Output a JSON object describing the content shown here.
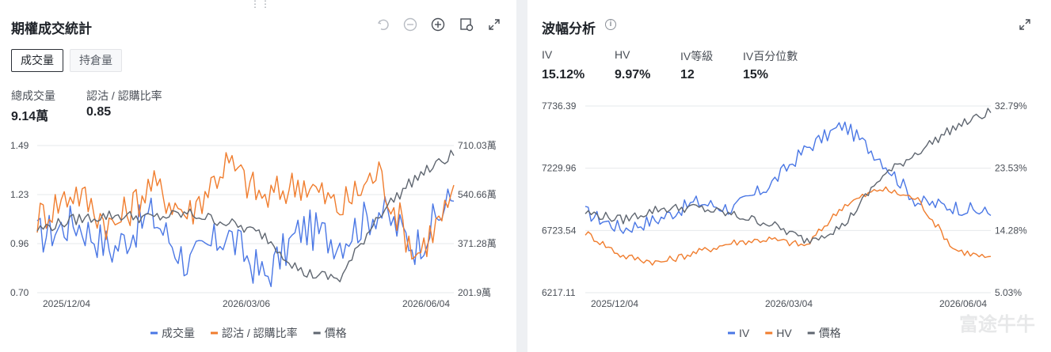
{
  "left": {
    "title": "期權成交統計",
    "tabs": [
      {
        "label": "成交量",
        "active": true
      },
      {
        "label": "持倉量",
        "active": false
      }
    ],
    "stats": [
      {
        "label": "總成交量",
        "value": "9.14萬"
      },
      {
        "label": "認沽 / 認購比率",
        "value": "0.85"
      }
    ]
  },
  "right": {
    "title": "波幅分析",
    "stats": [
      {
        "label": "IV",
        "value": "15.12%"
      },
      {
        "label": "HV",
        "value": "9.97%"
      },
      {
        "label": "IV等級",
        "value": "12"
      },
      {
        "label": "IV百分位數",
        "value": "15%"
      }
    ]
  },
  "watermark": "富途牛牛",
  "colors": {
    "blue": "#4a77e5",
    "orange": "#f07d2e",
    "gray": "#5f6670",
    "grid": "#e6e8eb"
  },
  "icons": [
    "undo-icon",
    "zoom-out-icon",
    "zoom-in-icon",
    "settings-icon",
    "expand-icon",
    "info-icon"
  ],
  "chart_data": [
    {
      "type": "line",
      "x_ticks": [
        "2025/12/04",
        "2026/03/06",
        "2026/06/04"
      ],
      "y_left": {
        "ticks": [
          "1.49",
          "1.23",
          "0.96",
          "0.70"
        ],
        "range": [
          0.7,
          1.49
        ]
      },
      "y_right": {
        "ticks": [
          "710.03萬",
          "540.66萬",
          "371.28萬",
          "201.9萬"
        ],
        "range": [
          201.9,
          710.03
        ],
        "unit": "萬"
      },
      "legend_position": "bottom",
      "grid": true,
      "series": [
        {
          "name": "成交量",
          "color": "#4a77e5",
          "axis": "left",
          "points": 12,
          "values": [
            1.0,
            1.08,
            0.93,
            1.12,
            0.85,
            1.02,
            0.78,
            1.05,
            0.98,
            1.15,
            0.95,
            1.22
          ]
        },
        {
          "name": "認沽 / 認購比率",
          "color": "#f07d2e",
          "axis": "left",
          "values": [
            1.1,
            1.25,
            1.05,
            1.28,
            1.12,
            1.4,
            1.2,
            1.3,
            1.15,
            1.35,
            0.9,
            1.2
          ]
        },
        {
          "name": "價格",
          "color": "#5f6670",
          "axis": "right",
          "values": [
            420,
            455,
            470,
            460,
            475,
            445,
            400,
            270,
            250,
            470,
            600,
            680
          ]
        }
      ]
    },
    {
      "type": "line",
      "x_ticks": [
        "2025/12/04",
        "2026/03/04",
        "2026/06/04"
      ],
      "y_left": {
        "ticks": [
          "7736.39",
          "7229.96",
          "6723.54",
          "6217.11"
        ],
        "range": [
          6217.11,
          7736.39
        ]
      },
      "y_right": {
        "ticks": [
          "32.79%",
          "23.53%",
          "14.28%",
          "5.03%"
        ],
        "range": [
          5.03,
          32.79
        ],
        "unit": "%"
      },
      "legend_position": "bottom",
      "grid": true,
      "series": [
        {
          "name": "IV",
          "color": "#4a77e5",
          "axis": "right",
          "values": [
            17.0,
            14.5,
            16.0,
            18.5,
            17.5,
            21.0,
            26.5,
            30.0,
            25.0,
            18.5,
            17.8,
            16.8
          ]
        },
        {
          "name": "HV",
          "color": "#f07d2e",
          "axis": "right",
          "values": [
            14.0,
            10.5,
            9.5,
            11.0,
            12.5,
            13.0,
            12.0,
            18.0,
            20.5,
            19.0,
            11.5,
            10.0
          ]
        },
        {
          "name": "價格",
          "color": "#5f6670",
          "axis": "left",
          "values": [
            6870,
            6810,
            6900,
            6910,
            6850,
            6780,
            6640,
            6760,
            7150,
            7360,
            7560,
            7690
          ]
        }
      ]
    }
  ]
}
